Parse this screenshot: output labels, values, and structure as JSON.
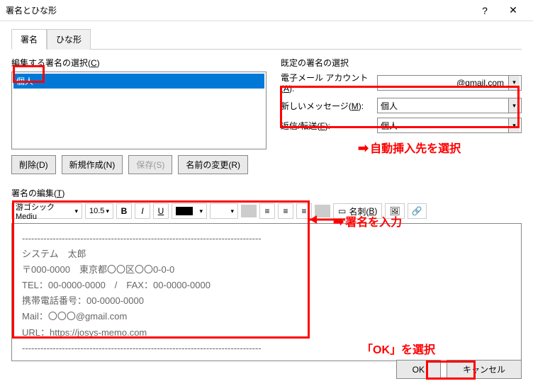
{
  "window": {
    "title": "署名とひな形",
    "help": "?",
    "close": "✕"
  },
  "tabs": {
    "signature": "署名",
    "template": "ひな形"
  },
  "left": {
    "select_label_pre": "編集する署名の選択(",
    "select_label_key": "C",
    "select_label_post": ")",
    "items": [
      "個人"
    ],
    "btn_delete": "削除(D)",
    "btn_new": "新規作成(N)",
    "btn_save": "保存(S)",
    "btn_rename": "名前の変更(R)"
  },
  "right": {
    "default_label": "既定の署名の選択",
    "email_label_pre": "電子メール アカウント(",
    "email_label_key": "A",
    "email_label_post": "):",
    "email_value": "@gmail.com",
    "newmsg_label_pre": "新しいメッセージ(",
    "newmsg_label_key": "M",
    "newmsg_label_post": "):",
    "newmsg_value": "個人",
    "reply_label_pre": "返信/転送(",
    "reply_label_key": "F",
    "reply_label_post": "):",
    "reply_value": "個人"
  },
  "edit": {
    "label_pre": "署名の編集(",
    "label_key": "T",
    "label_post": ")",
    "font": "游ゴシック Mediu",
    "size": "10.5",
    "bold": "B",
    "italic": "I",
    "underline_btn": "U",
    "card_pre": "名刺(",
    "card_key": "B",
    "card_post": ")",
    "body_lines": [
      "------------------------------------------------------------------------------",
      "システム　太郎",
      "〒000-0000　東京都〇〇区〇〇0-0-0",
      "TEL：00-0000-0000　/　FAX：00-0000-0000",
      "携帯電話番号：00-0000-0000",
      "Mail：〇〇〇@gmail.com",
      "URL：https://josys-memo.com",
      "------------------------------------------------------------------------------"
    ]
  },
  "footer": {
    "ok": "OK",
    "cancel": "キャンセル"
  },
  "annotations": {
    "auto_insert": "自動挿入先を選択",
    "enter_sig": "署名を入力",
    "select_ok": "「OK」を選択"
  }
}
